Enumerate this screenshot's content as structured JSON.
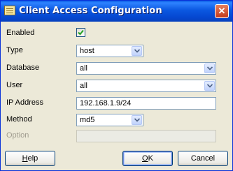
{
  "window": {
    "title": "Client Access Configuration",
    "close_glyph": "✕"
  },
  "form": {
    "enabled": {
      "label": "Enabled",
      "checked": true
    },
    "type": {
      "label": "Type",
      "value": "host"
    },
    "database": {
      "label": "Database",
      "value": "all"
    },
    "user": {
      "label": "User",
      "value": "all"
    },
    "ip_address": {
      "label": "IP Address",
      "value": "192.168.1.9/24"
    },
    "method": {
      "label": "Method",
      "value": "md5"
    },
    "option": {
      "label": "Option",
      "value": ""
    }
  },
  "buttons": {
    "help": {
      "pre": "",
      "mnemonic": "H",
      "post": "elp"
    },
    "ok": {
      "pre": "",
      "mnemonic": "O",
      "post": "K"
    },
    "cancel": {
      "label": "Cancel"
    }
  },
  "icons": {
    "title_icon": "app-icon",
    "check": "checkmark-icon",
    "dropdown": "chevron-down-icon"
  },
  "colors": {
    "titlebar": "#0a5ee4",
    "dialog_bg": "#ece9d8",
    "check_green": "#21a121"
  }
}
